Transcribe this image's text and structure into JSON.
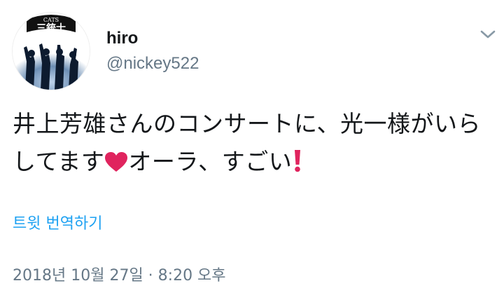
{
  "tweet": {
    "avatar": {
      "logo_top_text": "CATS",
      "logo_text": "三銃士"
    },
    "display_name": "hiro",
    "handle": "@nickey522",
    "text_part1": "井上芳雄さんのコンサートに、光一様がいらしてます",
    "text_part2": "オーラ、すごい",
    "emojis": [
      "red-heart",
      "red-exclamation-mark"
    ],
    "translate_label": "트윗 번역하기",
    "timestamp": "2018년 10월 27일 · 8:20 오후"
  },
  "colors": {
    "text": "#14171a",
    "secondary": "#657786",
    "link": "#1da1f2",
    "heart": "#e0245e",
    "exclamation": "#e0245e"
  }
}
